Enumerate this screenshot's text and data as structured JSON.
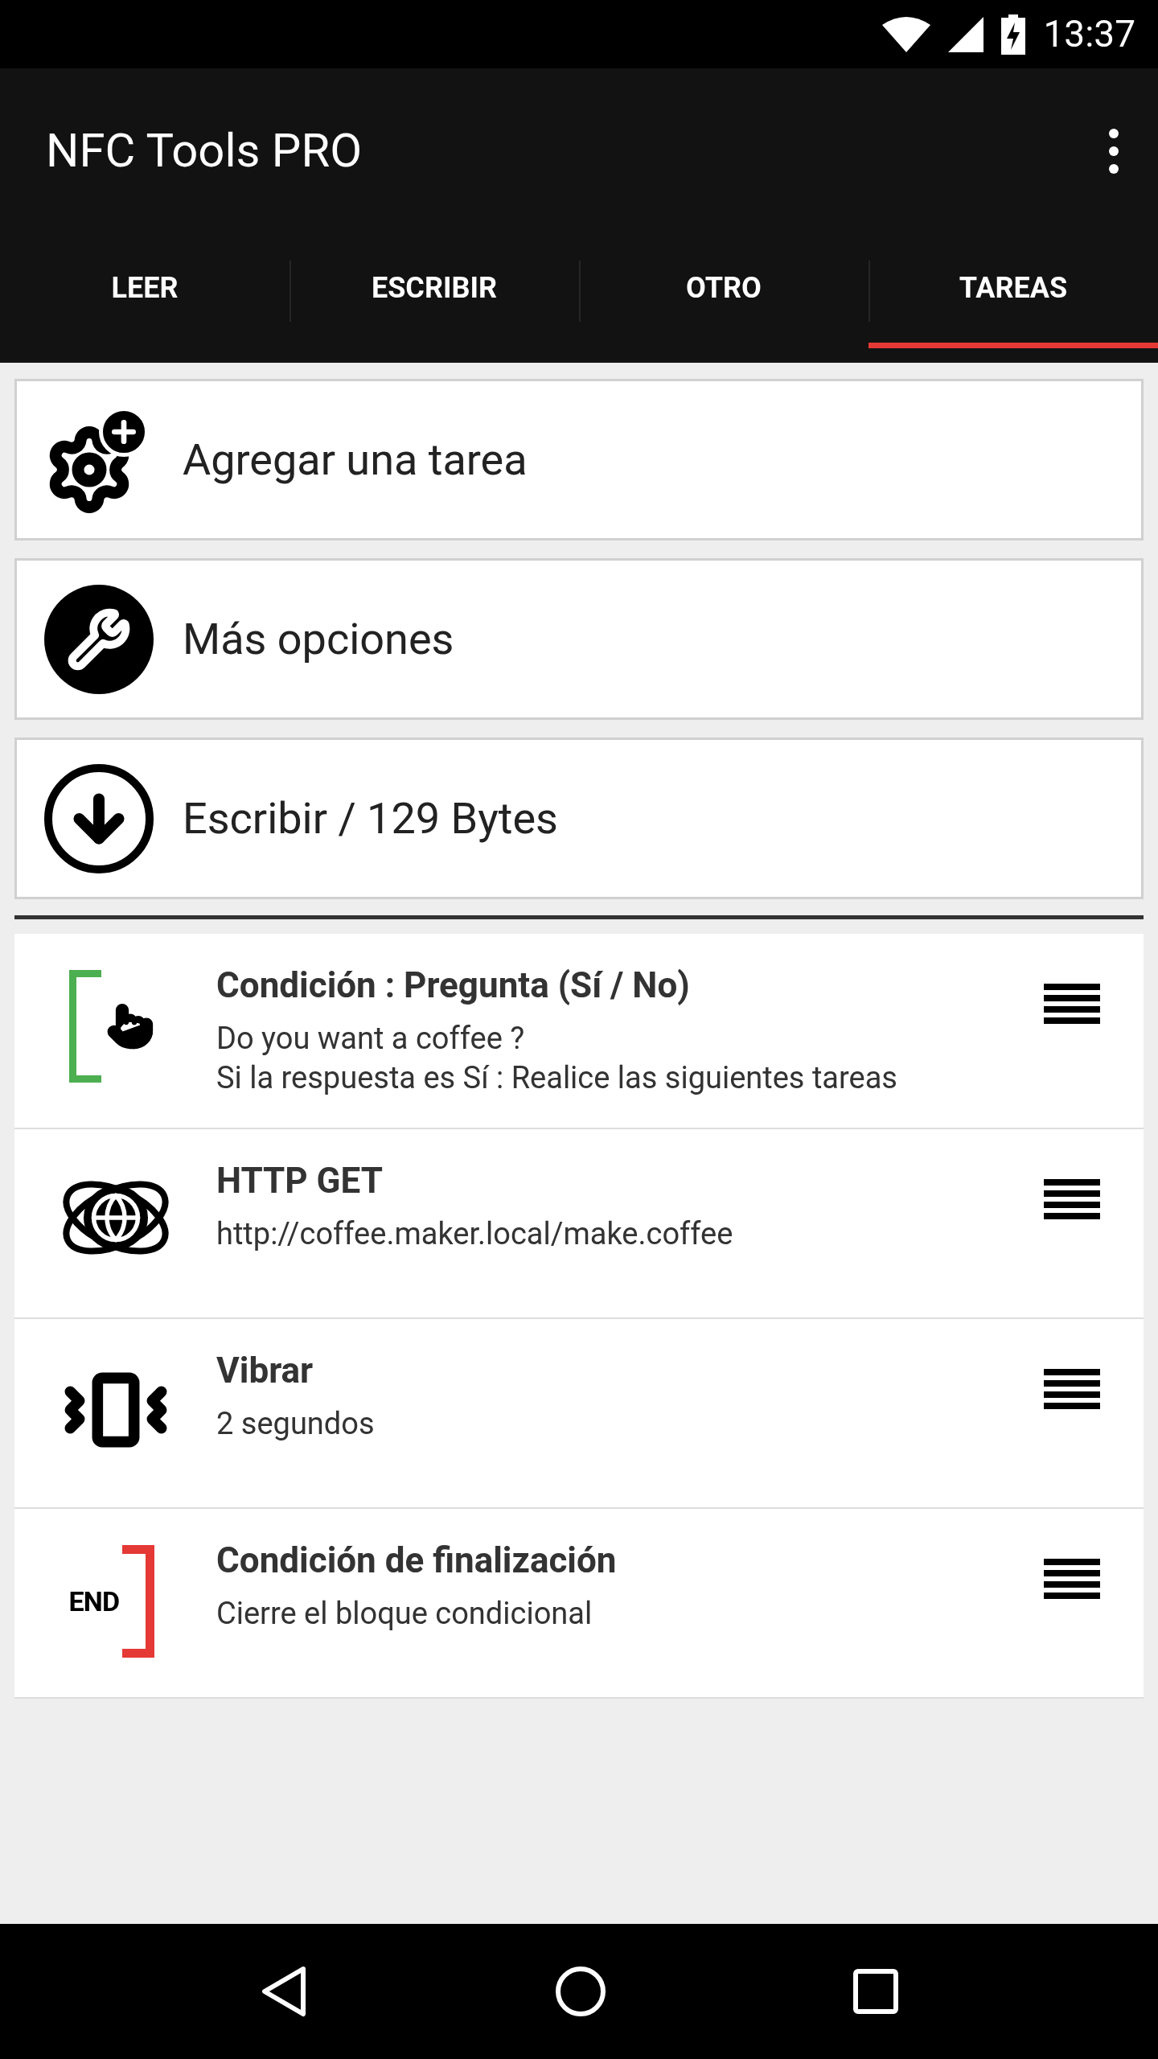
{
  "status_bar": {
    "time": "13:37"
  },
  "app_bar": {
    "title": "NFC Tools PRO"
  },
  "tabs": [
    {
      "label": "LEER",
      "selected": false
    },
    {
      "label": "ESCRIBIR",
      "selected": false
    },
    {
      "label": "OTRO",
      "selected": false
    },
    {
      "label": "TAREAS",
      "selected": true
    }
  ],
  "actions": [
    {
      "kind": "add",
      "label": "Agregar una tarea"
    },
    {
      "kind": "options",
      "label": "Más opciones"
    },
    {
      "kind": "write",
      "label": "Escribir / 129 Bytes"
    }
  ],
  "tasks": [
    {
      "kind": "condition",
      "title": "Condición : Pregunta (Sí / No)",
      "lines": [
        "Do you want a coffee ?",
        "Si la respuesta es Sí : Realice las siguientes tareas"
      ]
    },
    {
      "kind": "http",
      "title": "HTTP GET",
      "lines": [
        "http://coffee.maker.local/make.coffee"
      ]
    },
    {
      "kind": "vibrate",
      "title": "Vibrar",
      "lines": [
        "2 segundos"
      ]
    },
    {
      "kind": "end",
      "icon_text": "END",
      "title": "Condición de finalización",
      "lines": [
        "Cierre el bloque condicional"
      ]
    }
  ]
}
